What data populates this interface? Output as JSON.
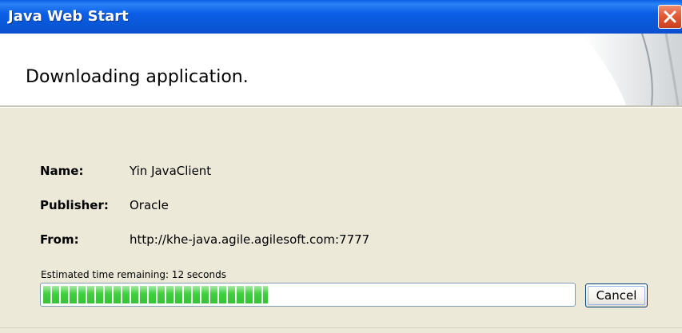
{
  "window": {
    "title": "Java Web Start"
  },
  "header": {
    "title": "Downloading application."
  },
  "info": [
    {
      "label": "Name:",
      "value": "Yin JavaClient"
    },
    {
      "label": "Publisher:",
      "value": "Oracle"
    },
    {
      "label": "From:",
      "value": "http://khe-java.agile.agilesoft.com:7777"
    }
  ],
  "download": {
    "status_text": "Estimated time remaining: 12 seconds",
    "progress_fraction": 0.425
  },
  "buttons": {
    "cancel": "Cancel"
  },
  "colors": {
    "titlebar": "#0b5fe6",
    "close": "#e35a36",
    "progress": "#3ed13c",
    "dialog_bg": "#ece9d8"
  },
  "icons": {
    "close": "close-icon"
  }
}
